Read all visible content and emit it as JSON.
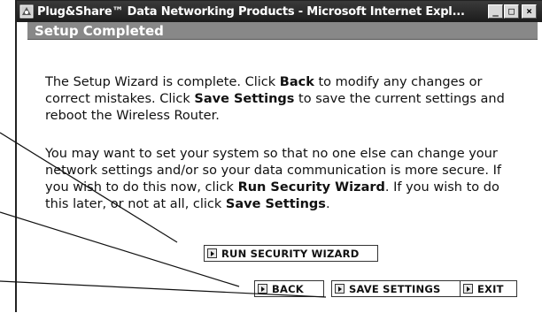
{
  "window": {
    "title": "Plug&Share™ Data Networking Products - Microsoft Internet Expl...",
    "icon": "ie-browser-icon",
    "controls": {
      "minimize": "_",
      "maximize": "□",
      "close": "×"
    }
  },
  "page": {
    "heading": "Setup Completed",
    "para1": {
      "t1": "The Setup Wizard is complete. Click ",
      "b1": "Back",
      "t2": " to modify any changes or correct mistakes. Click ",
      "b2": "Save Settings",
      "t3": " to save the current settings and reboot the Wireless Router."
    },
    "para2": {
      "t1": "You may want to set your system so that no one else can change your network settings and/or so your data communication is more secure. If you wish to do this now, click ",
      "b1": "Run Security Wizard",
      "t2": ". If you wish to do this later, or not at all, click ",
      "b2": "Save Settings",
      "t3": "."
    }
  },
  "buttons": {
    "run_security_wizard": "RUN SECURITY WIZARD",
    "back": "BACK",
    "save_settings": "SAVE SETTINGS",
    "exit": "EXIT"
  },
  "colors": {
    "titlebar": "#2a2a2a",
    "heading_bg": "#888888",
    "callout_line": "#111111"
  }
}
